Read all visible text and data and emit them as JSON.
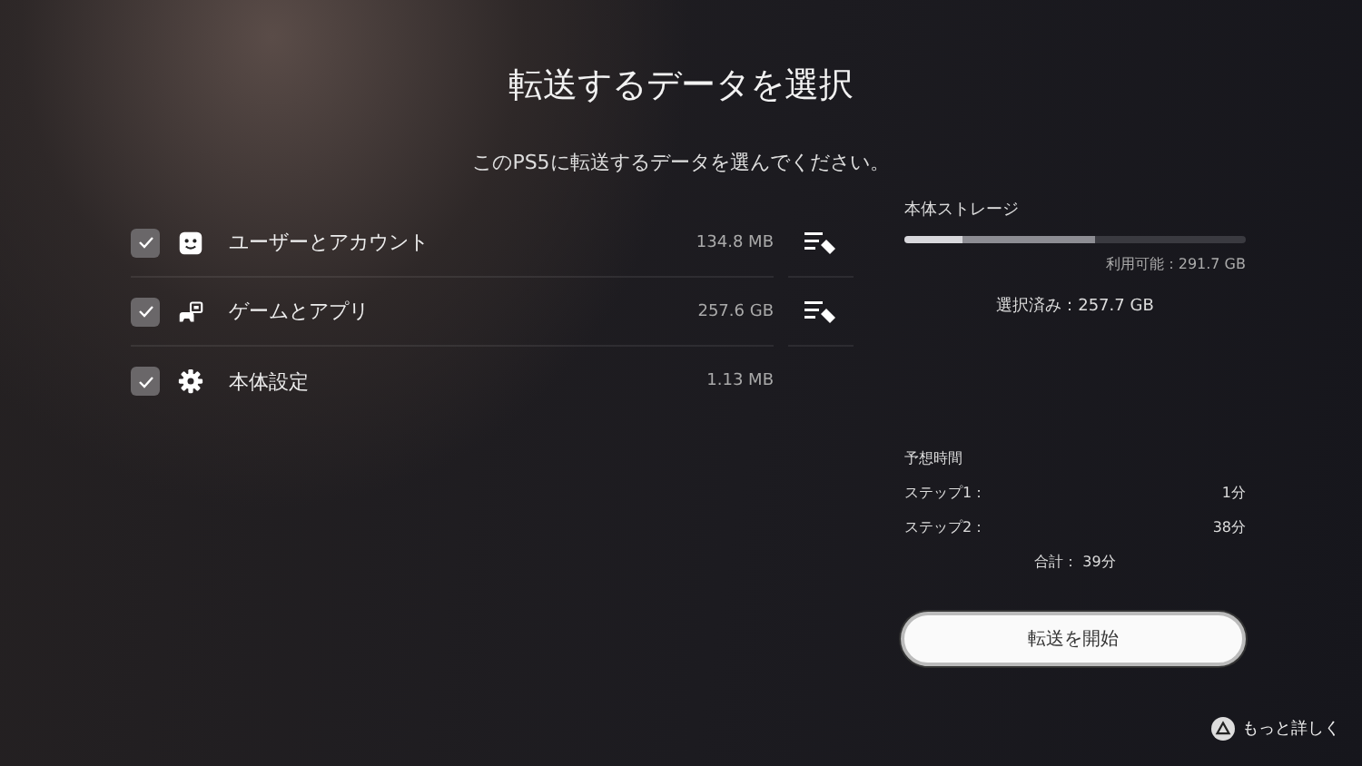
{
  "title": "転送するデータを選択",
  "subtitle": "このPS5に転送するデータを選んでください。",
  "items": [
    {
      "kind": "account",
      "label": "ユーザーとアカウント",
      "size": "134.8 MB",
      "checked": true,
      "editable": true
    },
    {
      "kind": "games",
      "label": "ゲームとアプリ",
      "size": "257.6 GB",
      "checked": true,
      "editable": true
    },
    {
      "kind": "settings",
      "label": "本体設定",
      "size": "1.13 MB",
      "checked": true,
      "editable": false
    }
  ],
  "storage": {
    "title": "本体ストレージ",
    "segments": [
      {
        "kind": "used",
        "level": 0.17
      },
      {
        "kind": "selected",
        "level": 0.39
      }
    ],
    "available": "利用可能：291.7 GB",
    "selected": "選択済み：257.7 GB"
  },
  "estimate": {
    "title": "予想時間",
    "steps": [
      {
        "label": "ステップ1：",
        "value": "1分"
      },
      {
        "label": "ステップ2：",
        "value": "38分"
      }
    ],
    "total": "合計： 39分"
  },
  "start_button": "転送を開始",
  "help": {
    "label": "もっと詳しく"
  }
}
